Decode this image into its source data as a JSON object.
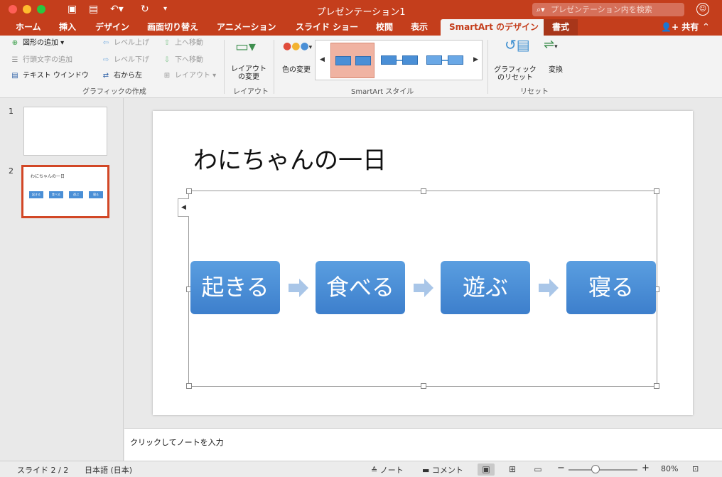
{
  "window": {
    "title": "プレゼンテーション1",
    "search_placeholder": "プレゼンテーション内を検索"
  },
  "tabs": [
    "ホーム",
    "挿入",
    "デザイン",
    "画面切り替え",
    "アニメーション",
    "スライド ショー",
    "校閲",
    "表示",
    "SmartArt のデザイン",
    "書式"
  ],
  "active_tab": "SmartArt のデザイン",
  "share_label": "共有",
  "ribbon": {
    "create_graphic": {
      "add_shape": "図形の追加",
      "add_bullet": "行頭文字の追加",
      "text_pane": "テキスト ウインドウ",
      "promote": "レベル上げ",
      "demote": "レベル下げ",
      "right_to_left": "右から左",
      "move_up": "上へ移動",
      "move_down": "下へ移動",
      "layout_dropdown": "レイアウト",
      "group_label": "グラフィックの作成"
    },
    "layouts": {
      "button_line1": "レイアウト",
      "button_line2": "の変更",
      "group_label": "レイアウト"
    },
    "styles": {
      "change_colors": "色の変更",
      "group_label": "SmartArt スタイル"
    },
    "reset": {
      "reset_line1": "グラフィック",
      "reset_line2": "のリセット",
      "convert": "変換",
      "group_label": "リセット"
    }
  },
  "slides_panel": {
    "slides": [
      {
        "number": "1"
      },
      {
        "number": "2",
        "title": "わにちゃんの一日",
        "boxes": [
          "起きる",
          "食べる",
          "遊ぶ",
          "寝る"
        ]
      }
    ],
    "selected": "2"
  },
  "slide": {
    "title": "わにちゃんの一日",
    "smartart_items": [
      "起きる",
      "食べる",
      "遊ぶ",
      "寝る"
    ]
  },
  "notes_placeholder": "クリックしてノートを入力",
  "status": {
    "slide_counter": "スライド 2 / 2",
    "language": "日本語 (日本)",
    "notes_label": "ノート",
    "comments_label": "コメント",
    "zoom": "80%"
  },
  "colors": {
    "accent": "#c43e1c",
    "smartart_fill": "#4a8fd6",
    "selected_thumb_border": "#d24726"
  }
}
